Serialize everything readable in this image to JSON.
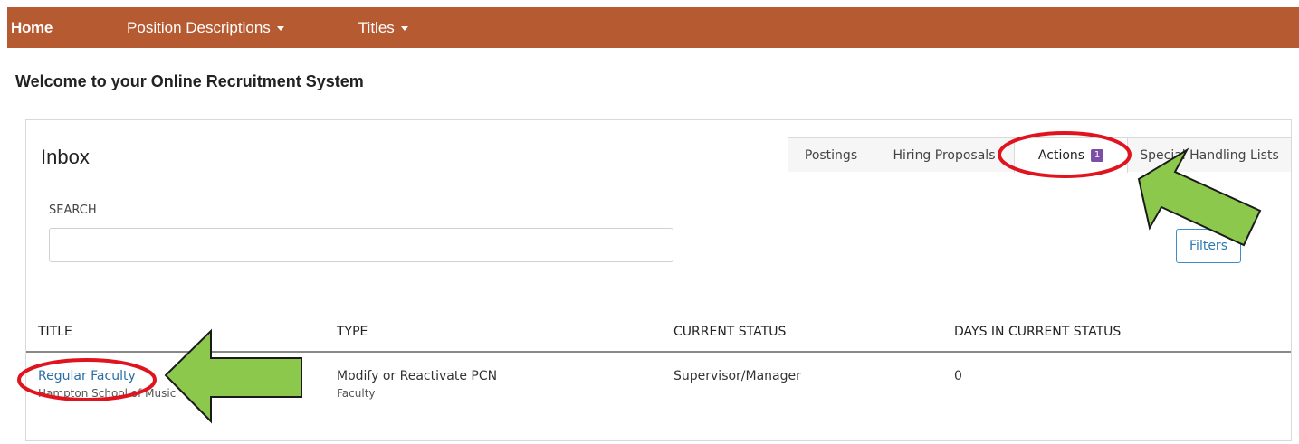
{
  "nav": {
    "home": "Home",
    "position_descriptions": "Position Descriptions",
    "titles": "Titles"
  },
  "welcome": "Welcome to your Online Recruitment System",
  "inbox": {
    "title": "Inbox",
    "tabs": [
      {
        "label": "Postings"
      },
      {
        "label": "Hiring Proposals"
      },
      {
        "label": "Actions",
        "badge": "1",
        "active": true
      },
      {
        "label": "Special Handling Lists"
      }
    ],
    "search_label": "SEARCH",
    "search_value": "",
    "filters_label": "Filters",
    "columns": [
      "TITLE",
      "TYPE",
      "CURRENT STATUS",
      "DAYS IN CURRENT STATUS"
    ],
    "rows": [
      {
        "title": "Regular Faculty",
        "title_sub": "Hampton School of Music",
        "type": "Modify or Reactivate PCN",
        "type_sub": "Faculty",
        "status": "Supervisor/Manager",
        "days": "0"
      }
    ]
  },
  "colors": {
    "nav_bg": "#b65a32",
    "link": "#2a6fa5",
    "badge": "#7b4fa8",
    "annotation_circle": "#e0141e",
    "annotation_arrow": "#8cc84b"
  }
}
